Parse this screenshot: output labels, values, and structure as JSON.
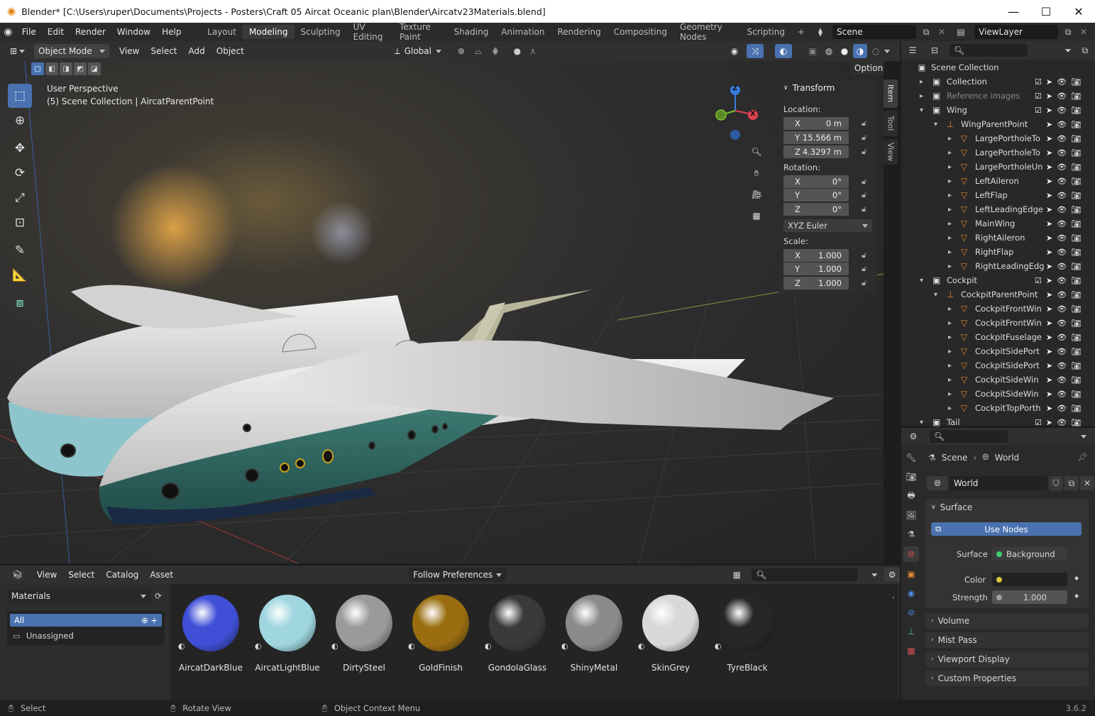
{
  "window": {
    "title": "Blender* [C:\\Users\\ruper\\Documents\\Projects - Posters\\Craft 05 Aircat Oceanic plan\\Blender\\Aircatv23Materials.blend]"
  },
  "menus": [
    "File",
    "Edit",
    "Render",
    "Window",
    "Help"
  ],
  "workspaces": [
    "Layout",
    "Modeling",
    "Sculpting",
    "UV Editing",
    "Texture Paint",
    "Shading",
    "Animation",
    "Rendering",
    "Compositing",
    "Geometry Nodes",
    "Scripting"
  ],
  "active_workspace": "Modeling",
  "scene": "Scene",
  "view_layer": "ViewLayer",
  "header": {
    "mode": "Object Mode",
    "menus": [
      "View",
      "Select",
      "Add",
      "Object"
    ],
    "orientation": "Global",
    "options": "Options"
  },
  "viewport": {
    "perspective": "User Perspective",
    "context": "(5) Scene Collection | AircatParentPoint"
  },
  "gizmo": {
    "z": "Z",
    "x": "X"
  },
  "transform": {
    "title": "Transform",
    "location_label": "Location:",
    "location": [
      {
        "axis": "X",
        "value": "0 m"
      },
      {
        "axis": "Y",
        "value": "15.566 m"
      },
      {
        "axis": "Z",
        "value": "4.3297 m"
      }
    ],
    "rotation_label": "Rotation:",
    "rotation": [
      {
        "axis": "X",
        "value": "0°"
      },
      {
        "axis": "Y",
        "value": "0°"
      },
      {
        "axis": "Z",
        "value": "0°"
      }
    ],
    "rotation_mode": "XYZ Euler",
    "scale_label": "Scale:",
    "scale": [
      {
        "axis": "X",
        "value": "1.000"
      },
      {
        "axis": "Y",
        "value": "1.000"
      },
      {
        "axis": "Z",
        "value": "1.000"
      }
    ]
  },
  "side_tabs": [
    "Item",
    "Tool",
    "View"
  ],
  "outliner": {
    "root": "Scene Collection",
    "rows": [
      {
        "label": "Collection",
        "depth": 0,
        "type": "collection"
      },
      {
        "label": "Reference images",
        "depth": 0,
        "type": "collection",
        "dim": true
      },
      {
        "label": "Wing",
        "depth": 0,
        "type": "collection",
        "open": true
      },
      {
        "label": "WingParentPoint",
        "depth": 1,
        "type": "empty",
        "open": true
      },
      {
        "label": "LargePortholeTo",
        "depth": 2,
        "type": "mesh"
      },
      {
        "label": "LargePortholeTo",
        "depth": 2,
        "type": "mesh"
      },
      {
        "label": "LargePortholeUn",
        "depth": 2,
        "type": "mesh"
      },
      {
        "label": "LeftAileron",
        "depth": 2,
        "type": "mesh"
      },
      {
        "label": "LeftFlap",
        "depth": 2,
        "type": "mesh"
      },
      {
        "label": "LeftLeadingEdge",
        "depth": 2,
        "type": "mesh"
      },
      {
        "label": "MainWing",
        "depth": 2,
        "type": "mesh"
      },
      {
        "label": "RightAileron",
        "depth": 2,
        "type": "mesh"
      },
      {
        "label": "RightFlap",
        "depth": 2,
        "type": "mesh"
      },
      {
        "label": "RightLeadingEdg",
        "depth": 2,
        "type": "mesh"
      },
      {
        "label": "Cockpit",
        "depth": 0,
        "type": "collection",
        "open": true
      },
      {
        "label": "CockpitParentPoint",
        "depth": 1,
        "type": "empty",
        "open": true
      },
      {
        "label": "CockpitFrontWin",
        "depth": 2,
        "type": "mesh"
      },
      {
        "label": "CockpitFrontWin",
        "depth": 2,
        "type": "mesh"
      },
      {
        "label": "CockpitFuselage",
        "depth": 2,
        "type": "mesh"
      },
      {
        "label": "CockpitSidePort",
        "depth": 2,
        "type": "mesh"
      },
      {
        "label": "CockpitSidePort",
        "depth": 2,
        "type": "mesh"
      },
      {
        "label": "CockpitSideWin",
        "depth": 2,
        "type": "mesh"
      },
      {
        "label": "CockpitSideWin",
        "depth": 2,
        "type": "mesh"
      },
      {
        "label": "CockpitTopPorth",
        "depth": 2,
        "type": "mesh"
      },
      {
        "label": "Tail",
        "depth": 0,
        "type": "collection",
        "open": true
      }
    ]
  },
  "properties": {
    "breadcrumb": [
      "Scene",
      "World"
    ],
    "world_name": "World",
    "surface_title": "Surface",
    "use_nodes": "Use Nodes",
    "surface_label": "Surface",
    "surface_value": "Background",
    "color_label": "Color",
    "strength_label": "Strength",
    "strength_value": "1.000",
    "panels": [
      "Volume",
      "Mist Pass",
      "Viewport Display",
      "Custom Properties"
    ]
  },
  "asset_browser": {
    "menus": [
      "View",
      "Select",
      "Catalog",
      "Asset"
    ],
    "library": "Materials",
    "import": "Follow Preferences",
    "catalogs": [
      "All",
      "Unassigned"
    ],
    "materials": [
      {
        "name": "AircatDarkBlue",
        "color": "#3f4fd6"
      },
      {
        "name": "AircatLightBlue",
        "color": "#9fd6df"
      },
      {
        "name": "DirtySteel",
        "color": "#9a9a9a"
      },
      {
        "name": "GoldFinish",
        "color": "#9a6e10"
      },
      {
        "name": "GondolaGlass",
        "color": "#3a3a3a"
      },
      {
        "name": "ShinyMetal",
        "color": "#8a8a8a"
      },
      {
        "name": "SkinGrey",
        "color": "#d8d8d8"
      },
      {
        "name": "TyreBlack",
        "color": "#262626"
      }
    ]
  },
  "status": {
    "select": "Select",
    "rotate": "Rotate View",
    "context": "Object Context Menu",
    "version": "3.6.2"
  }
}
